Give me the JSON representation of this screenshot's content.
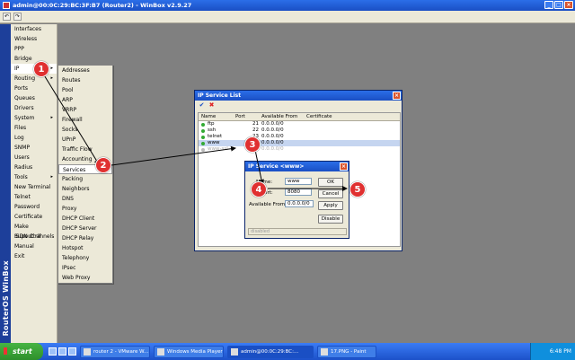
{
  "window_title": "admin@00:0C:29:BC:3F:B7 (Router2) - WinBox v2.9.27",
  "side_label": "RouterOS WinBox",
  "main_menu": [
    {
      "label": "Interfaces",
      "arrow": ""
    },
    {
      "label": "Wireless",
      "arrow": ""
    },
    {
      "label": "PPP",
      "arrow": ""
    },
    {
      "label": "Bridge",
      "arrow": ""
    },
    {
      "label": "IP",
      "arrow": "▸"
    },
    {
      "label": "Routing",
      "arrow": "▸"
    },
    {
      "label": "Ports",
      "arrow": ""
    },
    {
      "label": "Queues",
      "arrow": ""
    },
    {
      "label": "Drivers",
      "arrow": ""
    },
    {
      "label": "System",
      "arrow": "▸"
    },
    {
      "label": "Files",
      "arrow": ""
    },
    {
      "label": "Log",
      "arrow": ""
    },
    {
      "label": "SNMP",
      "arrow": ""
    },
    {
      "label": "Users",
      "arrow": ""
    },
    {
      "label": "Radius",
      "arrow": ""
    },
    {
      "label": "Tools",
      "arrow": "▸"
    },
    {
      "label": "New Terminal",
      "arrow": ""
    },
    {
      "label": "Telnet",
      "arrow": ""
    },
    {
      "label": "Password",
      "arrow": ""
    },
    {
      "label": "Certificate",
      "arrow": ""
    },
    {
      "label": "Make Supout.rif",
      "arrow": ""
    },
    {
      "label": "ISDN Channels",
      "arrow": ""
    },
    {
      "label": "Manual",
      "arrow": ""
    },
    {
      "label": "Exit",
      "arrow": ""
    }
  ],
  "ip_submenu": [
    "Addresses",
    "Routes",
    "Pool",
    "ARP",
    "VRRP",
    "Firewall",
    "Socks",
    "UPnP",
    "Traffic Flow",
    "Accounting",
    "Services",
    "Packing",
    "Neighbors",
    "DNS",
    "Proxy",
    "DHCP Client",
    "DHCP Server",
    "DHCP Relay",
    "Hotspot",
    "Telephony",
    "IPsec",
    "Web Proxy"
  ],
  "service_list": {
    "title": "IP Service List",
    "columns": [
      "Name",
      "Port",
      "Available From",
      "Certificate"
    ],
    "rows": [
      {
        "name": "ftp",
        "port": "21",
        "from": "0.0.0.0/0",
        "cert": ""
      },
      {
        "name": "ssh",
        "port": "22",
        "from": "0.0.0.0/0",
        "cert": ""
      },
      {
        "name": "telnet",
        "port": "23",
        "from": "0.0.0.0/0",
        "cert": ""
      },
      {
        "name": "www",
        "port": "80",
        "from": "0.0.0.0/0",
        "cert": ""
      },
      {
        "name": "www-ssl",
        "port": "443",
        "from": "0.0.0.0/0",
        "cert": ""
      }
    ]
  },
  "service_dialog": {
    "title": "IP Service <www>",
    "name_label": "Name:",
    "name_value": "www",
    "port_label": "Port:",
    "port_value": "8080",
    "from_label": "Available From:",
    "from_value": "0.0.0.0/0",
    "ok": "OK",
    "cancel": "Cancel",
    "apply": "Apply",
    "disable": "Disable",
    "status": "disabled"
  },
  "callouts": [
    "1",
    "2",
    "3",
    "4",
    "5"
  ],
  "taskbar": {
    "start": "start",
    "tasks": [
      "router 2 - VMware W...",
      "Windows Media Player",
      "admin@00:0C:29:BC:...",
      "17.PNG - Paint"
    ],
    "clock": "6:48 PM"
  }
}
